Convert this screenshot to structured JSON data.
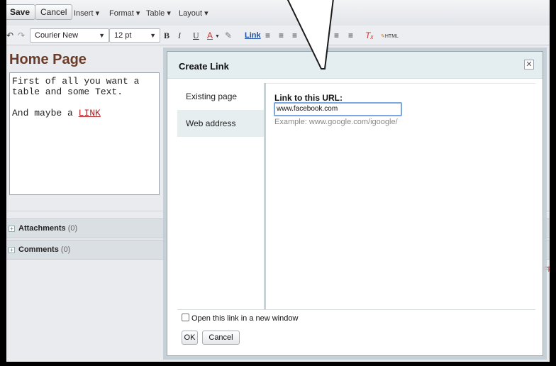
{
  "toolbar": {
    "save_label": "Save",
    "cancel_label": "Cancel",
    "menus": [
      "Insert ▾",
      "Format ▾",
      "Table ▾",
      "Layout ▾"
    ],
    "font_family": "Courier New",
    "font_size": "12 pt",
    "link_label": "Link",
    "bold": "B",
    "italic": "I",
    "underline": "U",
    "text_color": "A",
    "html_label": "HTML"
  },
  "page": {
    "title": "Home Page",
    "editor_lines": [
      "First of all you want a",
      "table and some Text.",
      "",
      "And maybe a "
    ],
    "editor_link": "LINK"
  },
  "sections": [
    {
      "label": "Attachments",
      "count": "(0)"
    },
    {
      "label": "Comments",
      "count": "(0)"
    }
  ],
  "side_link": "Rep",
  "dialog": {
    "title": "Create Link",
    "close": "✕",
    "tabs": [
      {
        "label": "Existing page",
        "active": false
      },
      {
        "label": "Web address",
        "active": true
      }
    ],
    "url_label": "Link to this URL:",
    "url_value": "www.facebook.com",
    "example": "Example: www.google.com/igoogle/",
    "new_window_label": "Open this link in a new window",
    "new_window_checked": false,
    "ok_label": "OK",
    "cancel_label": "Cancel"
  },
  "colors": {
    "title": "#6b3b2a",
    "link": "#b22222",
    "input_focus": "#7ba7e3"
  }
}
